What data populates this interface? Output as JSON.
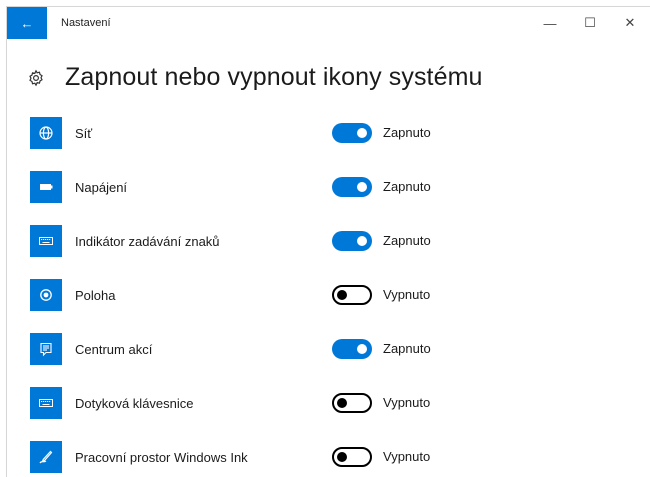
{
  "window": {
    "title": "Nastavení",
    "back_icon": "←",
    "minimize_icon": "—",
    "maximize_icon": "☐",
    "close_icon": "✕"
  },
  "page": {
    "title": "Zapnout nebo vypnout ikony systému"
  },
  "accent_color": "#0078d7",
  "items": [
    {
      "icon": "globe-icon",
      "label": "Síť",
      "on": true,
      "state": "Zapnuto"
    },
    {
      "icon": "battery-icon",
      "label": "Napájení",
      "on": true,
      "state": "Zapnuto"
    },
    {
      "icon": "keyboard-icon",
      "label": "Indikátor zadávání znaků",
      "on": true,
      "state": "Zapnuto"
    },
    {
      "icon": "location-icon",
      "label": "Poloha",
      "on": false,
      "state": "Vypnuto"
    },
    {
      "icon": "action-center-icon",
      "label": "Centrum akcí",
      "on": true,
      "state": "Zapnuto"
    },
    {
      "icon": "keyboard-icon",
      "label": "Dotyková klávesnice",
      "on": false,
      "state": "Vypnuto"
    },
    {
      "icon": "pen-icon",
      "label": "Pracovní prostor Windows Ink",
      "on": false,
      "state": "Vypnuto"
    }
  ]
}
